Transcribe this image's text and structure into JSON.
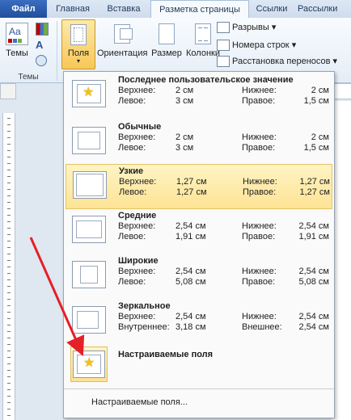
{
  "tabs": [
    "Файл",
    "Главная",
    "Вставка",
    "Разметка страницы",
    "Ссылки",
    "Рассылки"
  ],
  "ribbon": {
    "themes_label": "Темы",
    "themes_group": "Темы",
    "margins_label": "Поля",
    "orientation_label": "Ориентация",
    "size_label": "Размер",
    "columns_label": "Колонки",
    "breaks_label": "Разрывы",
    "line_numbers_label": "Номера строк",
    "hyphenation_label": "Расстановка переносов"
  },
  "margins_menu": {
    "options": [
      {
        "name": "Последнее пользовательское значение",
        "a_label": "Верхнее:",
        "a": "2 см",
        "b_label": "Нижнее:",
        "b": "2 см",
        "c_label": "Левое:",
        "c": "3 см",
        "d_label": "Правое:",
        "d": "1,5 см"
      },
      {
        "name": "Обычные",
        "a_label": "Верхнее:",
        "a": "2 см",
        "b_label": "Нижнее:",
        "b": "2 см",
        "c_label": "Левое:",
        "c": "3 см",
        "d_label": "Правое:",
        "d": "1,5 см"
      },
      {
        "name": "Узкие",
        "a_label": "Верхнее:",
        "a": "1,27 см",
        "b_label": "Нижнее:",
        "b": "1,27 см",
        "c_label": "Левое:",
        "c": "1,27 см",
        "d_label": "Правое:",
        "d": "1,27 см"
      },
      {
        "name": "Средние",
        "a_label": "Верхнее:",
        "a": "2,54 см",
        "b_label": "Нижнее:",
        "b": "2,54 см",
        "c_label": "Левое:",
        "c": "1,91 см",
        "d_label": "Правое:",
        "d": "1,91 см"
      },
      {
        "name": "Широкие",
        "a_label": "Верхнее:",
        "a": "2,54 см",
        "b_label": "Нижнее:",
        "b": "2,54 см",
        "c_label": "Левое:",
        "c": "5,08 см",
        "d_label": "Правое:",
        "d": "5,08 см"
      },
      {
        "name": "Зеркальное",
        "a_label": "Верхнее:",
        "a": "2,54 см",
        "b_label": "Нижнее:",
        "b": "2,54 см",
        "c_label": "Внутреннее:",
        "c": "3,18 см",
        "d_label": "Внешнее:",
        "d": "2,54 см"
      }
    ],
    "custom_title": "Настраиваемые поля",
    "footer_link": "Настраиваемые поля..."
  }
}
